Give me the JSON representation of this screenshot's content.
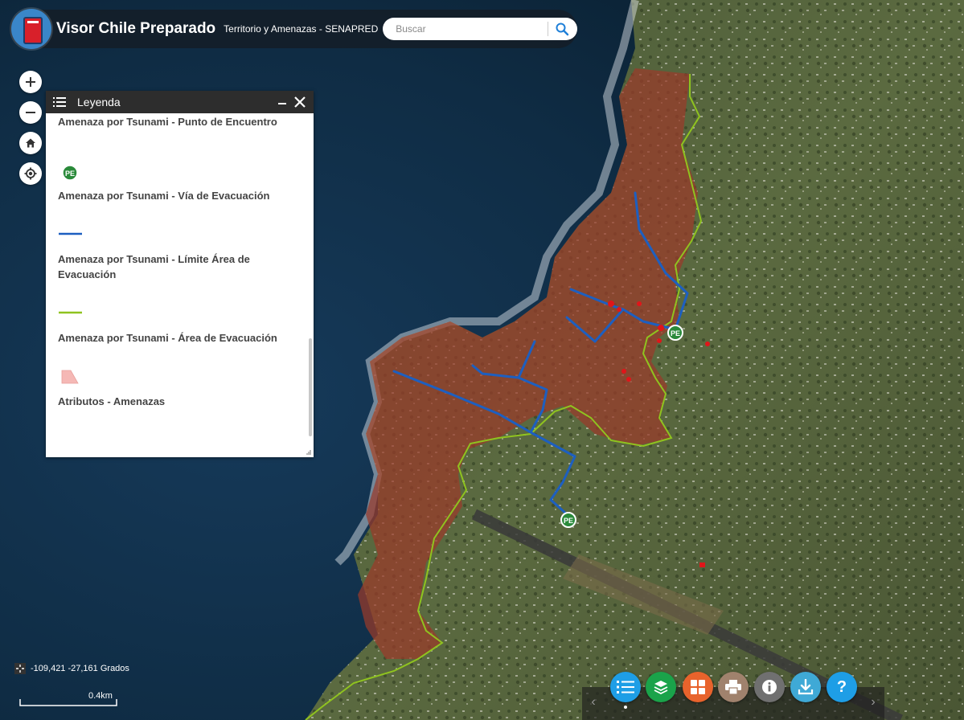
{
  "header": {
    "title": "Visor Chile Preparado",
    "subtitle": "Territorio y Amenazas - SENAPRED",
    "search_placeholder": "Buscar"
  },
  "legend": {
    "title": "Leyenda",
    "items": [
      {
        "title": "Amenaza por Tsunami - Punto de Encuentro",
        "symbol": "PE"
      },
      {
        "title": "Amenaza por Tsunami - Vía de Evacuación",
        "symbol": "blue-line"
      },
      {
        "title": "Amenaza por Tsunami - Límite Área de Evacuación",
        "symbol": "green-line"
      },
      {
        "title": "Amenaza por Tsunami - Área de Evacuación",
        "symbol": "pink-area"
      },
      {
        "title": "Atributos - Amenazas",
        "symbol": ""
      }
    ]
  },
  "map": {
    "coordinates": "-109,421 -27,161 Grados",
    "scale_label": "0.4km",
    "marker_label": "PE"
  },
  "toolbar": {
    "buttons": [
      {
        "name": "legend-list-icon",
        "color": "#1e9ee6"
      },
      {
        "name": "layers-icon",
        "color": "#1aa34a"
      },
      {
        "name": "basemap-grid-icon",
        "color": "#e8632c"
      },
      {
        "name": "print-icon",
        "color": "#a0826d"
      },
      {
        "name": "info-icon",
        "color": "#707070"
      },
      {
        "name": "download-icon",
        "color": "#3fa9d6"
      },
      {
        "name": "help-icon",
        "color": "#1e9ee6"
      }
    ],
    "help_label": "?"
  },
  "colors": {
    "ocean": "#0f2c44",
    "evacuation_area": "#9a3a2a",
    "evacuation_route": "#1d5fc0",
    "evacuation_limit": "#8fc31f",
    "meeting_point": "#2a8a3a"
  }
}
